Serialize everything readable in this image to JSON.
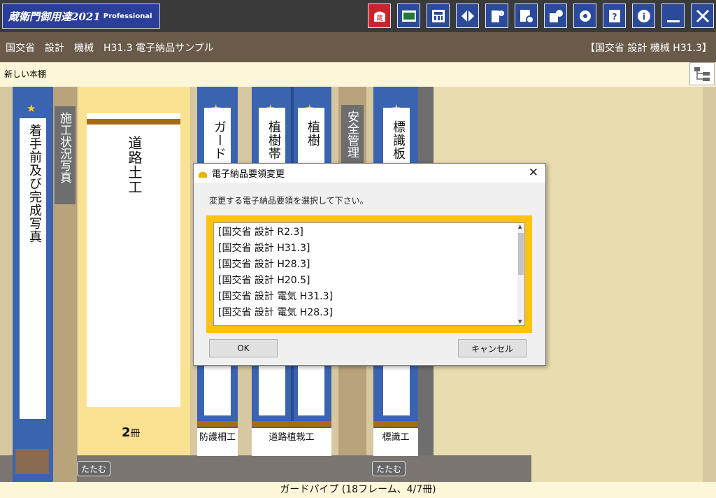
{
  "app": {
    "logo_main": "蔵衛門御用達2021",
    "logo_sub": "Professional"
  },
  "toolbar": {
    "buttons": [
      {
        "name": "kura-icon",
        "color": "#c9242b"
      },
      {
        "name": "board-icon"
      },
      {
        "name": "register-icon"
      },
      {
        "name": "split-icon"
      },
      {
        "name": "building-info-icon"
      },
      {
        "name": "document-settings-icon"
      },
      {
        "name": "building-settings-icon"
      },
      {
        "name": "gear-icon"
      },
      {
        "name": "help-icon"
      },
      {
        "name": "info-icon"
      },
      {
        "name": "minimize-icon"
      },
      {
        "name": "close-icon"
      }
    ]
  },
  "title": {
    "left": "国交省　設計　機械　H31.3 電子納品サンプル",
    "right": "【国交省 設計 機械 H31.3】"
  },
  "shelf_bar": {
    "name": "新しい本棚"
  },
  "books": {
    "b1": "着手前及び完成写真",
    "b2": "施工状況写真",
    "b3": "道路土工",
    "b3_count": "2",
    "b3_unit": "冊",
    "b4": "ガード",
    "b4_plate": "防護柵工",
    "b5": "植樹帯",
    "b6": "植樹",
    "b56_plate": "道路植栽工",
    "b7": "安全管理",
    "b8": "標識板",
    "b8_plate": "標識工",
    "fold_label": "たたむ"
  },
  "dialog": {
    "title": "電子納品要領変更",
    "message": "変更する電子納品要領を選択して下さい。",
    "options": [
      "[国交省 設計 R2.3]",
      "[国交省 設計 H31.3]",
      "[国交省 設計 H28.3]",
      "[国交省 設計 H20.5]",
      "[国交省 設計 電気 H31.3]",
      "[国交省 設計 電気 H28.3]"
    ],
    "ok_label": "OK",
    "cancel_label": "キャンセル"
  },
  "status": {
    "text": "ガードパイプ (18フレーム、4/7冊)"
  },
  "colors": {
    "accent_blue": "#2b4a99",
    "highlight": "#ffc20e",
    "title_bar": "#6a5a49"
  }
}
